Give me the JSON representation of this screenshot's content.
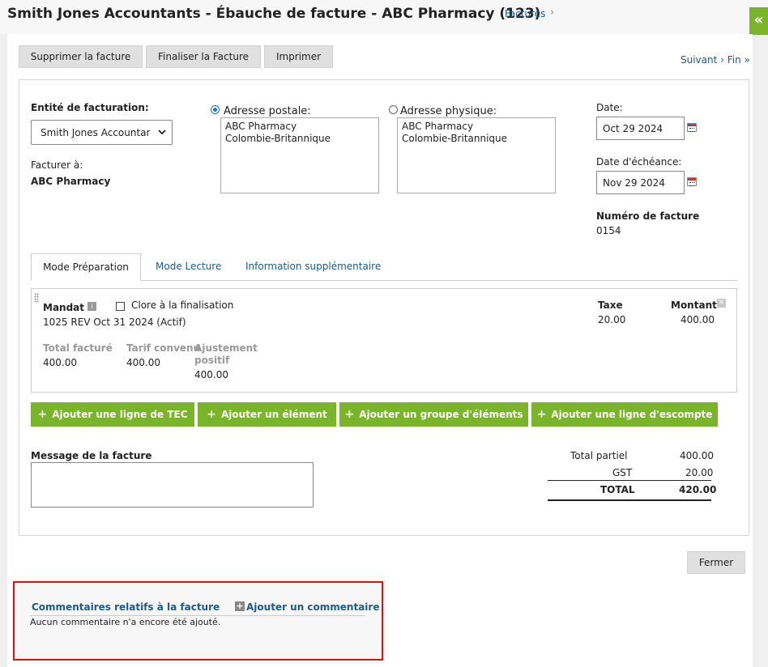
{
  "header": {
    "title": "Smith Jones Accountants - Ébauche de facture - ABC Pharmacy (123)",
    "breadcrumb": "Factures",
    "breadcrumb_sep": "›",
    "collapse_icon": "«"
  },
  "toolbar": {
    "delete_label": "Supprimer la facture",
    "finalize_label": "Finaliser la Facture",
    "print_label": "Imprimer",
    "next_label": "Suivant › Fin »"
  },
  "billing": {
    "entity_label": "Entité de facturation:",
    "entity_value": "Smith Jones Accountants",
    "bill_to_label": "Facturer à:",
    "bill_to_value": "ABC Pharmacy"
  },
  "addresses": {
    "postal_label": "Adresse postale:",
    "postal_lines": [
      "ABC Pharmacy",
      "Colombie-Britannique"
    ],
    "physical_label": "Adresse physique:",
    "physical_lines": [
      "ABC Pharmacy",
      "Colombie-Britannique"
    ],
    "selected": "postal"
  },
  "dates": {
    "date_label": "Date:",
    "date_value": "Oct 29 2024",
    "due_label": "Date d'échéance:",
    "due_value": "Nov 29 2024",
    "invoice_no_label": "Numéro de facture",
    "invoice_no_value": "0154"
  },
  "tabs": [
    {
      "label": "Mode Préparation",
      "active": true
    },
    {
      "label": "Mode Lecture",
      "active": false
    },
    {
      "label": "Information supplémentaire",
      "active": false
    }
  ],
  "mandate": {
    "label": "Mandat",
    "info_icon": "i",
    "close_label": "Clore à la finalisation",
    "desc": "1025 REV Oct 31 2024 (Actif)",
    "tax_label": "Taxe",
    "tax_value": "20.00",
    "amount_label": "Montant",
    "amount_value": "400.00",
    "remove_icon": "✕",
    "total_billed_label": "Total facturé",
    "total_billed_value": "400.00",
    "agreed_rate_label": "Tarif convenu",
    "agreed_rate_value": "400.00",
    "adjustment_label_1": "Ajustement",
    "adjustment_label_2": "positif",
    "adjustment_value": "400.00"
  },
  "add_buttons": {
    "plus": "+",
    "tec": "Ajouter une ligne de TEC",
    "item": "Ajouter un élément",
    "group": "Ajouter un groupe d'éléments",
    "discount": "Ajouter une ligne d'escompte"
  },
  "message": {
    "label": "Message de la facture",
    "value": ""
  },
  "totals": {
    "subtotal_label": "Total partiel",
    "subtotal_value": "400.00",
    "gst_label": "GST",
    "gst_value": "20.00",
    "total_label": "TOTAL",
    "total_value": "420.00"
  },
  "close_label": "Fermer",
  "comments": {
    "title": "Commentaires relatifs à la facture",
    "add_icon": "+",
    "add_label": "Ajouter un commentaire",
    "empty": "Aucun commentaire n'a encore été ajouté."
  }
}
